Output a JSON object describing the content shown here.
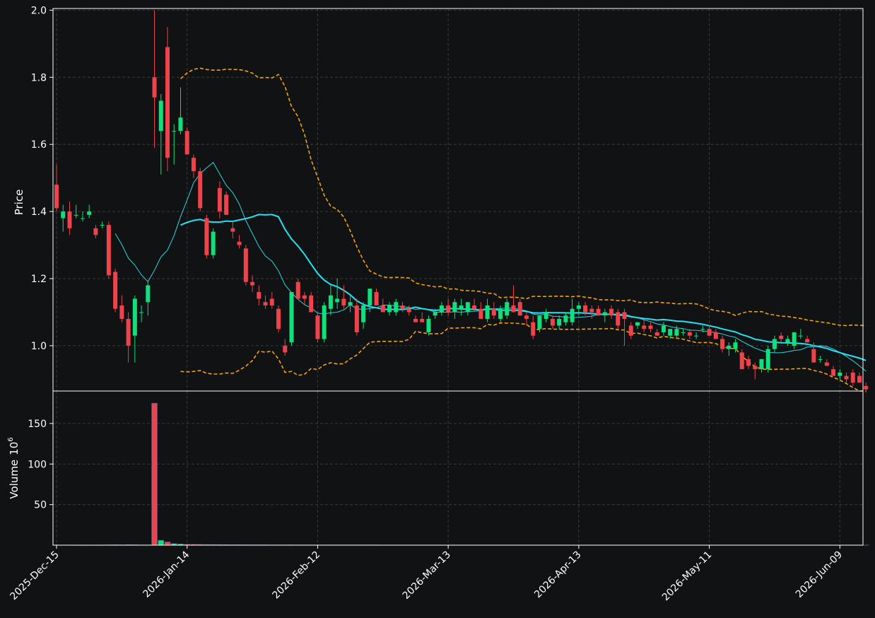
{
  "chart_data": {
    "type": "candlestick",
    "panels": {
      "price": {
        "ylabel": "Price",
        "ylim": [
          0.865,
          2.005
        ],
        "yticks": [
          "1.0",
          "1.2",
          "1.4",
          "1.6",
          "1.8",
          "2.0"
        ]
      },
      "volume": {
        "ylabel": "Volume",
        "unit_exp": "6",
        "ylim": [
          0,
          190
        ],
        "yticks": [
          "50",
          "100",
          "150"
        ]
      }
    },
    "x_tick_labels": [
      "2025-Dec-15",
      "2026-Jan-14",
      "2026-Feb-12",
      "2026-Mar-13",
      "2026-Apr-13",
      "2026-May-11",
      "2026-Jun-09"
    ],
    "x_tick_index": [
      0,
      20,
      40,
      60,
      80,
      100,
      120
    ],
    "num_bars": 124,
    "grid": true,
    "overlays": [
      {
        "kind": "moving_average",
        "period": 10,
        "color": "#2ad7e0"
      },
      {
        "kind": "moving_average",
        "period": 20,
        "color": "#22e3f5"
      },
      {
        "kind": "bollinger_upper",
        "color": "#f5a20e",
        "style": "dashed"
      },
      {
        "kind": "bollinger_lower",
        "color": "#f5a20e",
        "style": "dashed"
      }
    ],
    "colors": {
      "up": "#10e07c",
      "down": "#f0424a",
      "background": "#111213",
      "grid": "#3a3a3a",
      "axes": "#ffffff"
    },
    "ohlcv": [
      [
        1.48,
        1.54,
        1.4,
        1.41,
        0.3
      ],
      [
        1.38,
        1.42,
        1.34,
        1.4,
        0.2
      ],
      [
        1.4,
        1.43,
        1.33,
        1.35,
        0.2
      ],
      [
        1.39,
        1.42,
        1.38,
        1.39,
        0.1
      ],
      [
        1.38,
        1.4,
        1.37,
        1.38,
        0.1
      ],
      [
        1.39,
        1.42,
        1.38,
        1.4,
        0.1
      ],
      [
        1.35,
        1.36,
        1.32,
        1.33,
        0.2
      ],
      [
        1.36,
        1.37,
        1.35,
        1.36,
        0.1
      ],
      [
        1.36,
        1.37,
        1.2,
        1.21,
        0.4
      ],
      [
        1.22,
        1.23,
        1.1,
        1.11,
        0.5
      ],
      [
        1.12,
        1.15,
        1.07,
        1.08,
        0.4
      ],
      [
        1.08,
        1.1,
        0.95,
        1.0,
        0.6
      ],
      [
        1.03,
        1.15,
        0.95,
        1.14,
        0.5
      ],
      [
        1.1,
        1.12,
        1.07,
        1.1,
        0.3
      ],
      [
        1.13,
        1.19,
        1.09,
        1.18,
        0.3
      ],
      [
        1.8,
        2.0,
        1.59,
        1.74,
        175
      ],
      [
        1.64,
        1.75,
        1.51,
        1.73,
        6
      ],
      [
        1.89,
        1.95,
        1.52,
        1.56,
        4
      ],
      [
        1.64,
        1.66,
        1.54,
        1.64,
        2
      ],
      [
        1.64,
        1.77,
        1.63,
        1.68,
        1.5
      ],
      [
        1.64,
        1.65,
        1.57,
        1.57,
        1
      ],
      [
        1.56,
        1.57,
        1.5,
        1.52,
        1
      ],
      [
        1.52,
        1.53,
        1.4,
        1.41,
        0.9
      ],
      [
        1.38,
        1.39,
        1.26,
        1.27,
        0.8
      ],
      [
        1.27,
        1.35,
        1.26,
        1.34,
        0.7
      ],
      [
        1.47,
        1.49,
        1.38,
        1.4,
        0.7
      ],
      [
        1.45,
        1.46,
        1.4,
        1.39,
        0.6
      ],
      [
        1.35,
        1.37,
        1.32,
        1.34,
        0.5
      ],
      [
        1.31,
        1.33,
        1.29,
        1.3,
        0.5
      ],
      [
        1.29,
        1.3,
        1.18,
        1.19,
        0.5
      ],
      [
        1.19,
        1.21,
        1.16,
        1.18,
        0.4
      ],
      [
        1.16,
        1.18,
        1.12,
        1.14,
        0.4
      ],
      [
        1.13,
        1.15,
        1.11,
        1.12,
        0.4
      ],
      [
        1.14,
        1.16,
        1.11,
        1.12,
        0.3
      ],
      [
        1.11,
        1.12,
        1.04,
        1.05,
        0.3
      ],
      [
        1.0,
        1.02,
        0.97,
        0.98,
        0.3
      ],
      [
        1.01,
        1.16,
        1.0,
        1.16,
        0.4
      ],
      [
        1.19,
        1.2,
        1.14,
        1.14,
        0.3
      ],
      [
        1.15,
        1.16,
        1.12,
        1.14,
        0.3
      ],
      [
        1.15,
        1.16,
        1.1,
        1.1,
        0.3
      ],
      [
        1.09,
        1.1,
        1.01,
        1.02,
        0.3
      ],
      [
        1.02,
        1.13,
        1.01,
        1.12,
        0.3
      ],
      [
        1.11,
        1.18,
        1.09,
        1.15,
        0.3
      ],
      [
        1.13,
        1.2,
        1.11,
        1.14,
        0.3
      ],
      [
        1.14,
        1.18,
        1.11,
        1.12,
        0.3
      ],
      [
        1.12,
        1.15,
        1.1,
        1.13,
        0.3
      ],
      [
        1.12,
        1.14,
        1.03,
        1.04,
        0.3
      ],
      [
        1.07,
        1.13,
        1.05,
        1.12,
        0.3
      ],
      [
        1.12,
        1.17,
        1.1,
        1.17,
        0.3
      ],
      [
        1.16,
        1.17,
        1.12,
        1.12,
        0.3
      ],
      [
        1.12,
        1.14,
        1.1,
        1.1,
        0.2
      ],
      [
        1.1,
        1.13,
        1.09,
        1.12,
        0.2
      ],
      [
        1.1,
        1.14,
        1.09,
        1.13,
        0.2
      ],
      [
        1.12,
        1.13,
        1.1,
        1.11,
        0.2
      ],
      [
        1.11,
        1.12,
        1.09,
        1.1,
        0.2
      ],
      [
        1.08,
        1.09,
        1.07,
        1.07,
        0.2
      ],
      [
        1.08,
        1.1,
        1.07,
        1.07,
        0.2
      ],
      [
        1.04,
        1.09,
        1.03,
        1.08,
        0.2
      ],
      [
        1.09,
        1.11,
        1.08,
        1.1,
        0.2
      ],
      [
        1.1,
        1.13,
        1.09,
        1.12,
        0.2
      ],
      [
        1.12,
        1.14,
        1.09,
        1.1,
        0.2
      ],
      [
        1.1,
        1.14,
        1.08,
        1.13,
        0.2
      ],
      [
        1.11,
        1.14,
        1.09,
        1.12,
        0.2
      ],
      [
        1.1,
        1.13,
        1.09,
        1.13,
        0.2
      ],
      [
        1.12,
        1.14,
        1.1,
        1.11,
        0.2
      ],
      [
        1.11,
        1.13,
        1.08,
        1.08,
        0.2
      ],
      [
        1.08,
        1.14,
        1.07,
        1.12,
        0.2
      ],
      [
        1.11,
        1.13,
        1.08,
        1.09,
        0.2
      ],
      [
        1.08,
        1.12,
        1.07,
        1.11,
        0.2
      ],
      [
        1.09,
        1.14,
        1.08,
        1.13,
        0.2
      ],
      [
        1.12,
        1.18,
        1.1,
        1.1,
        0.2
      ],
      [
        1.13,
        1.14,
        1.09,
        1.09,
        0.2
      ],
      [
        1.09,
        1.1,
        1.06,
        1.08,
        0.2
      ],
      [
        1.07,
        1.09,
        1.02,
        1.03,
        0.2
      ],
      [
        1.05,
        1.09,
        1.04,
        1.09,
        0.2
      ],
      [
        1.08,
        1.11,
        1.07,
        1.1,
        0.2
      ],
      [
        1.08,
        1.09,
        1.05,
        1.06,
        0.2
      ],
      [
        1.06,
        1.09,
        1.05,
        1.08,
        0.2
      ],
      [
        1.07,
        1.1,
        1.06,
        1.09,
        0.2
      ],
      [
        1.07,
        1.14,
        1.06,
        1.11,
        0.2
      ],
      [
        1.11,
        1.13,
        1.09,
        1.12,
        0.2
      ],
      [
        1.12,
        1.13,
        1.09,
        1.1,
        0.2
      ],
      [
        1.11,
        1.12,
        1.08,
        1.1,
        0.2
      ],
      [
        1.11,
        1.12,
        1.09,
        1.09,
        0.2
      ],
      [
        1.09,
        1.11,
        1.07,
        1.1,
        0.2
      ],
      [
        1.11,
        1.12,
        1.08,
        1.09,
        0.2
      ],
      [
        1.1,
        1.11,
        1.05,
        1.06,
        0.2
      ],
      [
        1.1,
        1.11,
        1.0,
        1.08,
        0.2
      ],
      [
        1.06,
        1.07,
        1.02,
        1.03,
        0.2
      ],
      [
        1.06,
        1.07,
        1.05,
        1.07,
        0.2
      ],
      [
        1.06,
        1.08,
        1.04,
        1.05,
        0.2
      ],
      [
        1.06,
        1.07,
        1.04,
        1.05,
        0.2
      ],
      [
        1.04,
        1.05,
        1.03,
        1.03,
        0.2
      ],
      [
        1.04,
        1.07,
        1.03,
        1.06,
        0.2
      ],
      [
        1.03,
        1.05,
        1.02,
        1.05,
        0.2
      ],
      [
        1.03,
        1.06,
        1.02,
        1.05,
        0.2
      ],
      [
        1.04,
        1.05,
        1.03,
        1.04,
        0.2
      ],
      [
        1.04,
        1.05,
        1.02,
        1.03,
        0.2
      ],
      [
        1.03,
        1.04,
        1.02,
        1.03,
        0.2
      ],
      [
        1.05,
        1.06,
        1.04,
        1.05,
        0.2
      ],
      [
        1.05,
        1.06,
        1.03,
        1.03,
        0.2
      ],
      [
        1.04,
        1.05,
        1.02,
        1.02,
        0.2
      ],
      [
        1.02,
        1.03,
        0.98,
        0.99,
        0.2
      ],
      [
        0.99,
        1.01,
        0.97,
        1.0,
        0.2
      ],
      [
        0.99,
        1.02,
        0.98,
        1.01,
        0.2
      ],
      [
        0.98,
        0.99,
        0.93,
        0.93,
        0.2
      ],
      [
        0.96,
        0.97,
        0.93,
        0.94,
        0.2
      ],
      [
        0.94,
        0.95,
        0.9,
        0.93,
        0.2
      ],
      [
        0.93,
        0.96,
        0.92,
        0.96,
        0.2
      ],
      [
        0.93,
        1.0,
        0.92,
        0.99,
        0.2
      ],
      [
        0.99,
        1.03,
        0.98,
        1.02,
        0.2
      ],
      [
        1.03,
        1.04,
        1.01,
        1.02,
        0.2
      ],
      [
        1.01,
        1.03,
        1.0,
        1.02,
        0.2
      ],
      [
        1.0,
        1.04,
        0.99,
        1.04,
        0.2
      ],
      [
        1.03,
        1.05,
        1.02,
        1.03,
        0.2
      ],
      [
        1.02,
        1.03,
        1.01,
        1.01,
        0.2
      ],
      [
        0.99,
        1.01,
        0.95,
        0.95,
        0.2
      ],
      [
        0.96,
        0.97,
        0.95,
        0.96,
        0.2
      ],
      [
        0.95,
        0.96,
        0.94,
        0.94,
        0.2
      ],
      [
        0.93,
        0.94,
        0.91,
        0.91,
        0.2
      ],
      [
        0.91,
        0.93,
        0.9,
        0.92,
        0.2
      ],
      [
        0.91,
        0.92,
        0.89,
        0.9,
        0.2
      ],
      [
        0.92,
        0.93,
        0.88,
        0.89,
        0.2
      ],
      [
        0.91,
        0.92,
        0.89,
        0.89,
        0.2
      ],
      [
        0.88,
        0.89,
        0.86,
        0.87,
        0.2
      ]
    ]
  }
}
